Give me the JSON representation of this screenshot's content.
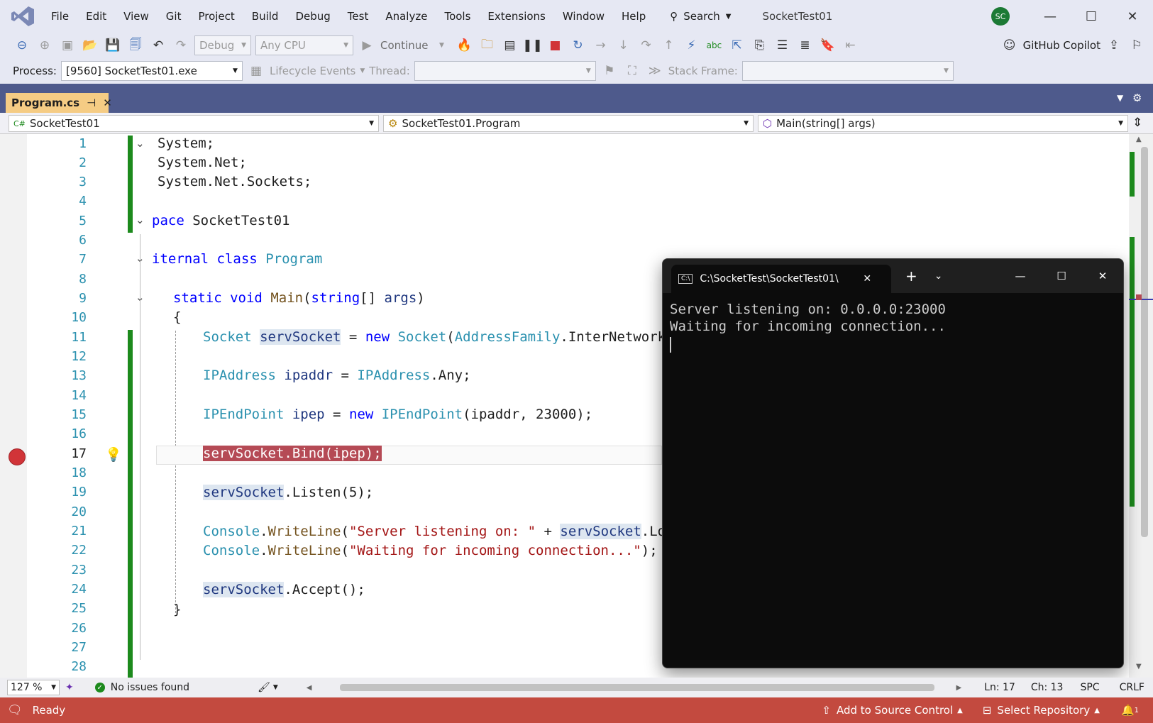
{
  "menu": [
    "File",
    "Edit",
    "View",
    "Git",
    "Project",
    "Build",
    "Debug",
    "Test",
    "Analyze",
    "Tools",
    "Extensions",
    "Window",
    "Help"
  ],
  "search_label": "Search",
  "project_title": "SocketTest01",
  "avatar_initials": "SC",
  "toolbar": {
    "config": "Debug",
    "platform": "Any CPU",
    "continue_label": "Continue",
    "copilot_label": "GitHub Copilot",
    "process_label": "Process:",
    "process_value": "[9560] SocketTest01.exe",
    "lifecycle_label": "Lifecycle Events",
    "thread_label": "Thread:",
    "stackframe_label": "Stack Frame:"
  },
  "doctab": {
    "label": "Program.cs"
  },
  "nav": {
    "project": "SocketTest01",
    "class": "SocketTest01.Program",
    "member": "Main(string[] args)"
  },
  "line_numbers": [
    "1",
    "2",
    "3",
    "4",
    "5",
    "6",
    "7",
    "8",
    "9",
    "10",
    "11",
    "12",
    "13",
    "14",
    "15",
    "16",
    "17",
    "18",
    "19",
    "20",
    "21",
    "22",
    "23",
    "24",
    "25",
    "26",
    "27",
    "28"
  ],
  "code": {
    "l1": "System;",
    "l2": "System.Net;",
    "l3": "System.Net.Sockets;",
    "l5a": "pace",
    "l5b": " SocketTest01",
    "l7a": "iternal",
    "l7b": "class",
    "l7c": "Program",
    "l9a": "static",
    "l9b": "void",
    "l9c": "Main",
    "l9d": "string",
    "l9e": "args",
    "brace_open": "{",
    "l11a": "Socket",
    "l11b": "servSocket",
    "l11c": "new",
    "l11d": "Socket",
    "l11e": "AddressFamily",
    "l11f": ".InterNetwork, So",
    "l13a": "IPAddress",
    "l13b": "ipaddr",
    "l13c": "IPAddress",
    "l13d": ".Any;",
    "l15a": "IPEndPoint",
    "l15b": "ipep",
    "l15c": "new",
    "l15d": "IPEndPoint",
    "l15e": "(ipaddr, 23000);",
    "l17": "servSocket.Bind(ipep);",
    "l19a": "servSocket",
    "l19b": ".Listen(5);",
    "l21a": "Console",
    "l21b": "WriteLine",
    "l21c": "\"Server listening on: \"",
    "l21d": "servSocket",
    "l21e": ".LocalE",
    "l22a": "Console",
    "l22b": "WriteLine",
    "l22c": "\"Waiting for incoming connection...\"",
    "l22d": ");",
    "l24a": "servSocket",
    "l24b": ".Accept();",
    "brace_close": "}"
  },
  "editor_status": {
    "zoom": "127 %",
    "issues": "No issues found",
    "ln": "Ln: 17",
    "ch": "Ch: 13",
    "spc": "SPC",
    "crlf": "CRLF"
  },
  "statusbar": {
    "ready": "Ready",
    "source_control": "Add to Source Control",
    "repository": "Select Repository",
    "notifications": "1"
  },
  "terminal": {
    "tab_title": "C:\\SocketTest\\SocketTest01\\",
    "line1": "Server listening on: 0.0.0.0:23000",
    "line2": "Waiting for incoming connection..."
  }
}
